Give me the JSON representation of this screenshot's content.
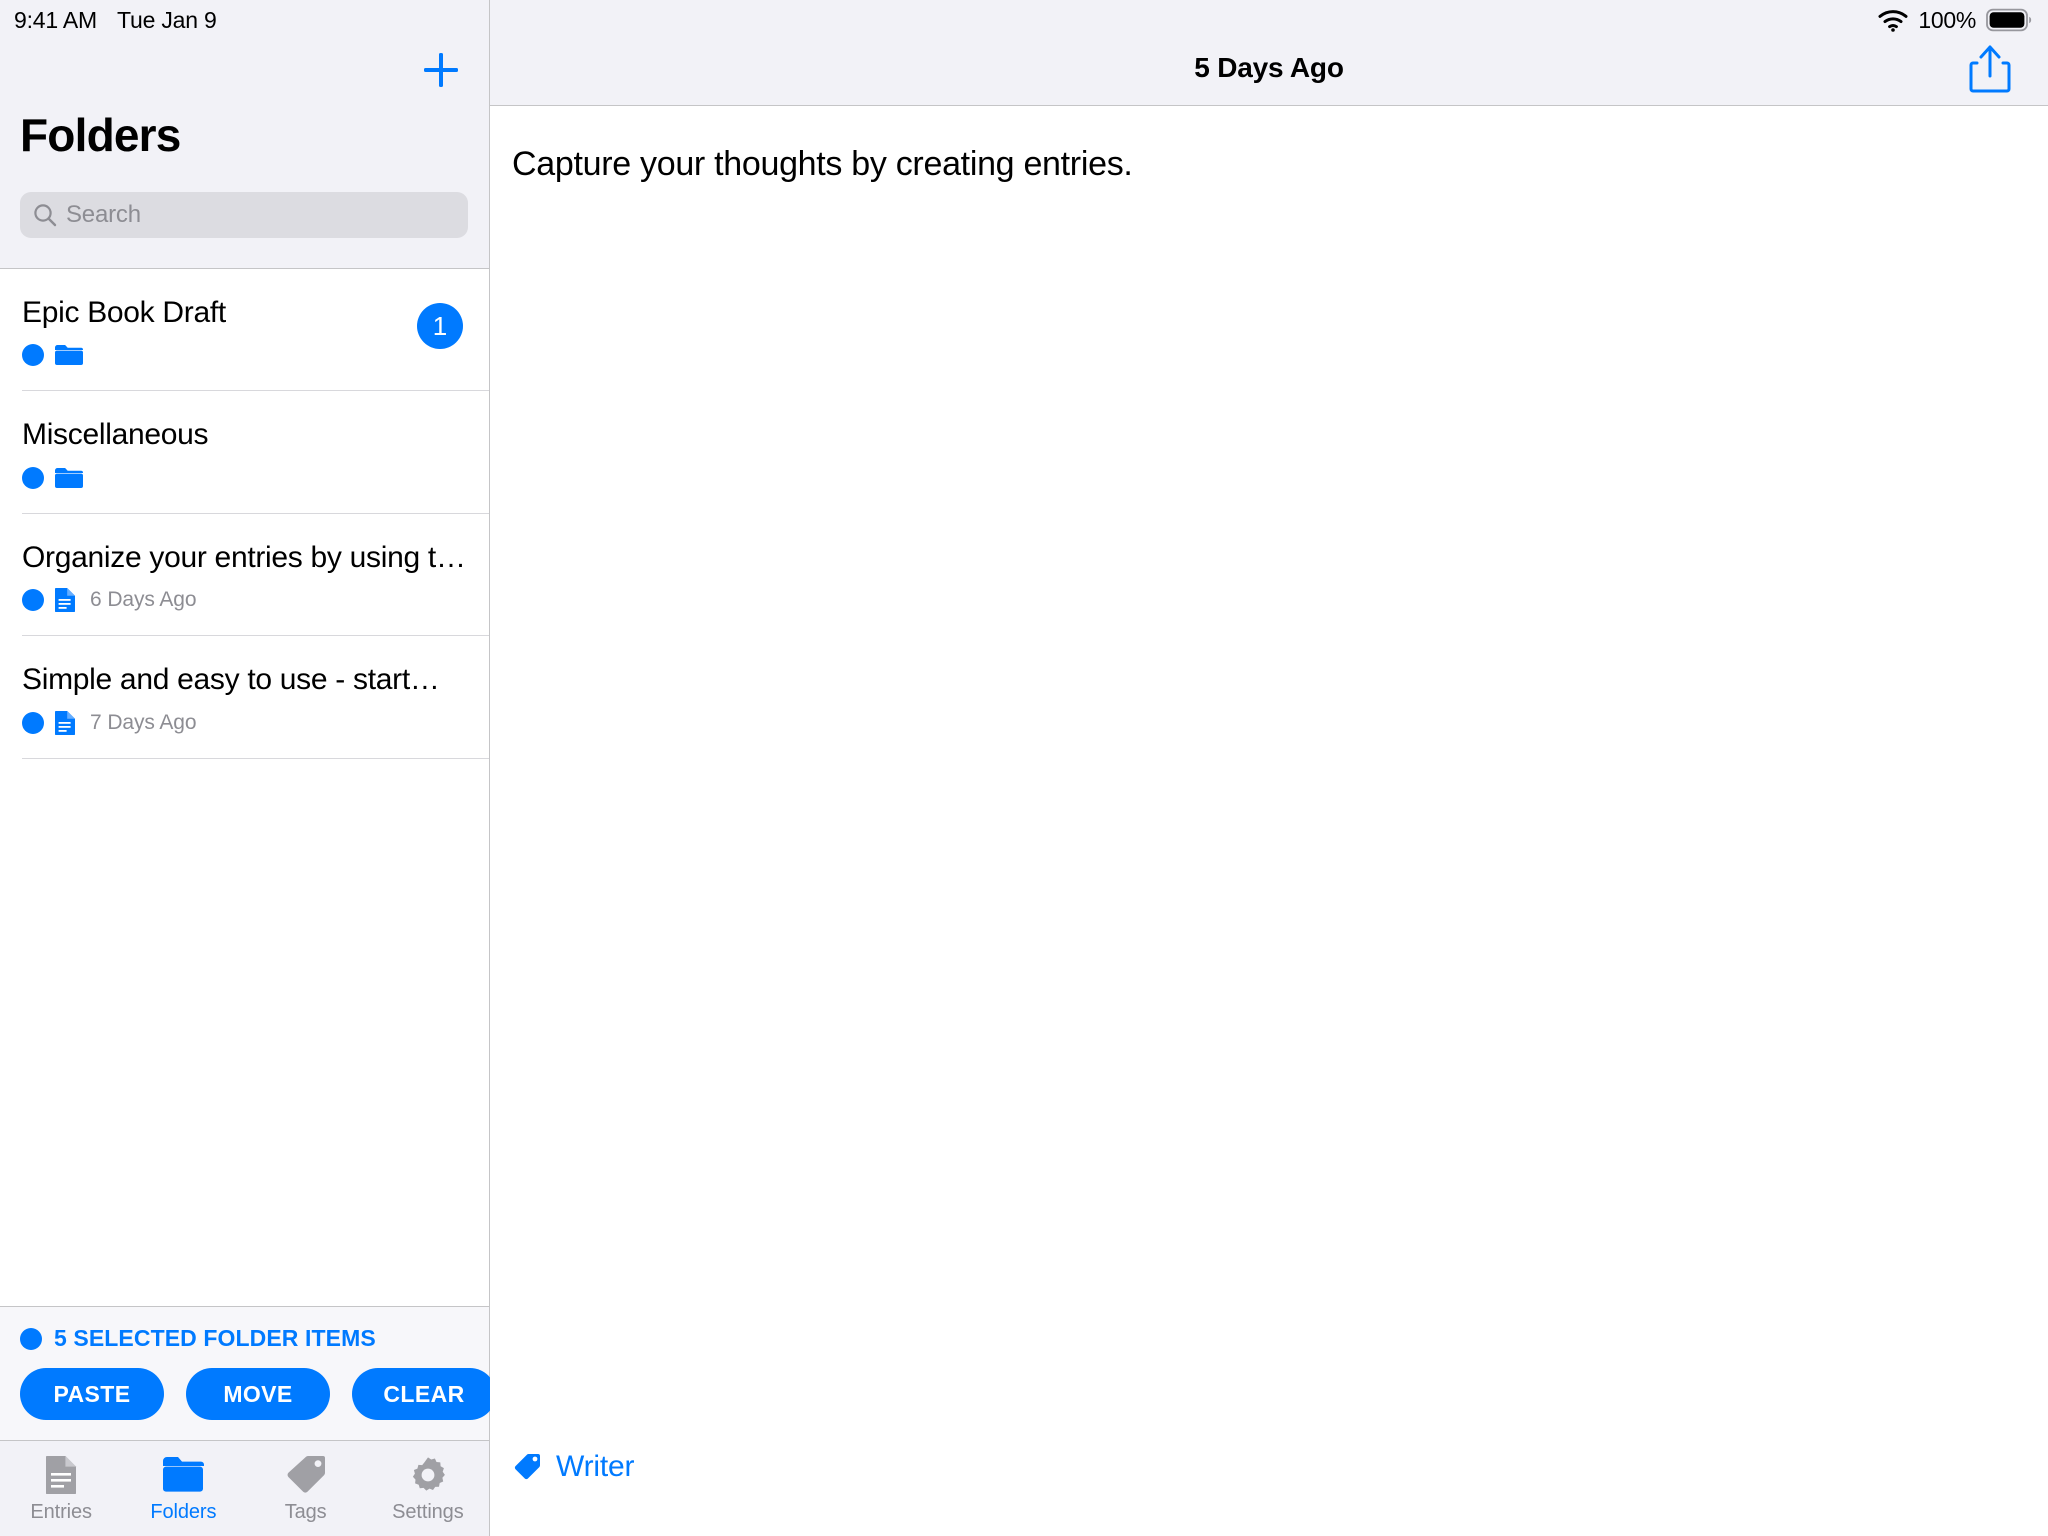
{
  "status_bar": {
    "time": "9:41 AM",
    "date": "Tue Jan 9",
    "battery_percent": "100%",
    "wifi_icon": "wifi-icon",
    "battery_icon": "battery-full-icon"
  },
  "sidebar": {
    "title": "Folders",
    "add_button_icon": "plus-icon",
    "search": {
      "placeholder": "Search",
      "value": "",
      "icon": "search-icon"
    },
    "rows": [
      {
        "title": "Epic Book Draft",
        "subtitle": "",
        "kind_icon": "folder-icon",
        "selected_icon": "blue-dot-icon",
        "badge": "1"
      },
      {
        "title": "Miscellaneous",
        "subtitle": "",
        "kind_icon": "folder-icon",
        "selected_icon": "blue-dot-icon",
        "badge": ""
      },
      {
        "title": "Organize your entries by using t…",
        "subtitle": "6 Days Ago",
        "kind_icon": "document-icon",
        "selected_icon": "blue-dot-icon",
        "badge": ""
      },
      {
        "title": "Simple and easy to use - start…",
        "subtitle": "7 Days Ago",
        "kind_icon": "document-icon",
        "selected_icon": "blue-dot-icon",
        "badge": ""
      }
    ],
    "selection": {
      "label": "5 SELECTED FOLDER ITEMS",
      "dot_icon": "blue-dot-icon",
      "buttons": [
        {
          "label": "PASTE",
          "name": "paste-button"
        },
        {
          "label": "MOVE",
          "name": "move-button"
        },
        {
          "label": "CLEAR",
          "name": "clear-button"
        }
      ]
    },
    "tabs": [
      {
        "label": "Entries",
        "icon": "document-icon",
        "active": false
      },
      {
        "label": "Folders",
        "icon": "folder-icon",
        "active": true
      },
      {
        "label": "Tags",
        "icon": "tag-icon",
        "active": false
      },
      {
        "label": "Settings",
        "icon": "gear-icon",
        "active": false
      }
    ]
  },
  "detail": {
    "title": "5 Days Ago",
    "share_icon": "share-icon",
    "body_text": "Capture your thoughts by creating entries.",
    "tag": {
      "icon": "tag-icon",
      "name": "Writer"
    }
  },
  "colors": {
    "accent": "#007aff",
    "sidebar_bg": "#f2f2f7",
    "list_bg": "#ffffff",
    "separator": "#d8d8dc",
    "muted_text": "#8d8d93"
  }
}
